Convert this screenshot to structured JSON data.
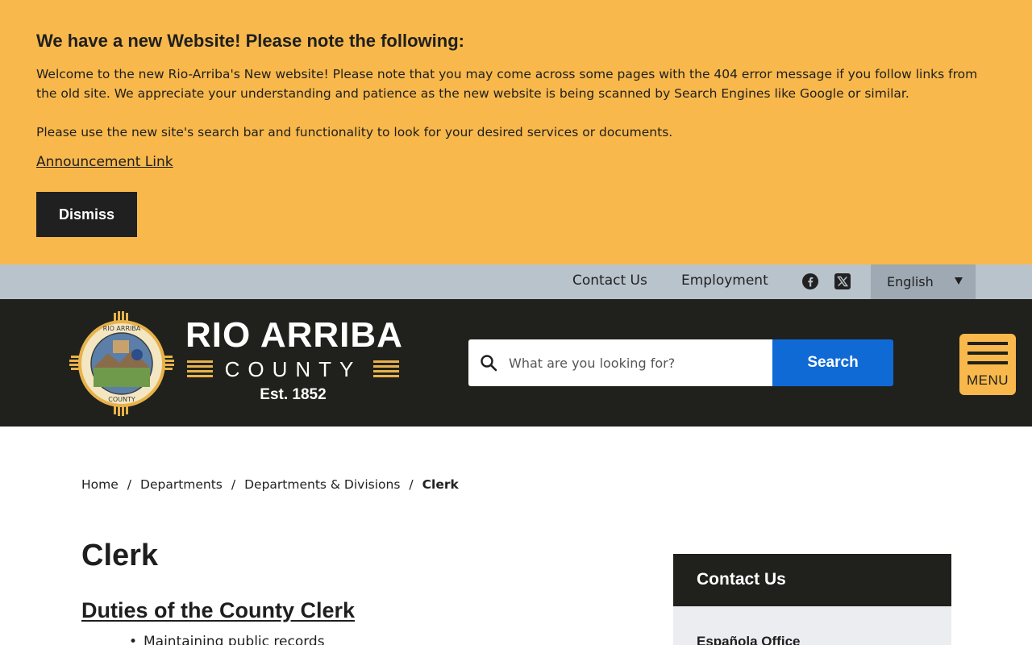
{
  "announcement": {
    "title": "We have a new Website! Please note the following:",
    "paragraph1": "Welcome to the new Rio-Arriba's New website! Please note that you may come across some pages with the 404 error message if you follow links from the old site. We appreciate your understanding and patience as the new website is being scanned by Search Engines like Google or similar.",
    "paragraph2": "Please use the new site's search bar and functionality to look for your desired services or documents.",
    "link_label": "Announcement Link",
    "dismiss_label": "Dismiss",
    "background_color": "#f8b84b"
  },
  "utility": {
    "contact_label": "Contact Us",
    "employment_label": "Employment",
    "social_icons": [
      "facebook-icon",
      "x-twitter-icon"
    ],
    "language": {
      "selected": "English"
    }
  },
  "header": {
    "brand_title": "RIO ARRIBA",
    "brand_county": "COUNTY",
    "brand_est": "Est. 1852",
    "search": {
      "placeholder": "What are you looking for?",
      "button_label": "Search"
    },
    "menu_label": "MENU",
    "accent_color": "#f8b84b",
    "search_button_color": "#0f6ad6"
  },
  "breadcrumb": {
    "items": [
      "Home",
      "Departments",
      "Departments & Divisions"
    ],
    "current": "Clerk",
    "separator": "/"
  },
  "main": {
    "title": "Clerk",
    "section_heading": "Duties of the County Clerk",
    "duties": [
      "Maintaining public records"
    ]
  },
  "sidebar": {
    "title": "Contact Us",
    "office_name": "Española Office"
  }
}
